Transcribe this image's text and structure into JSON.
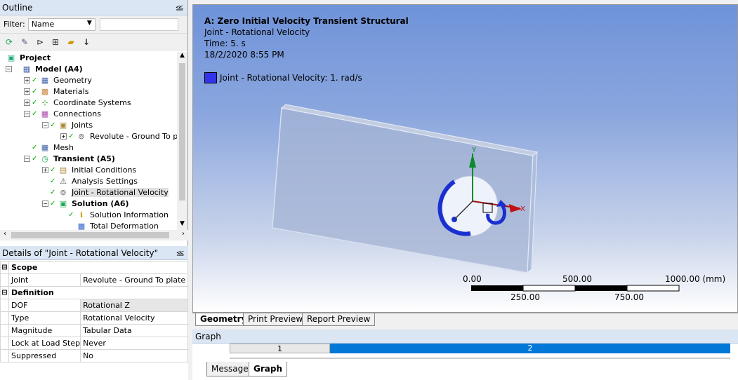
{
  "outline": {
    "title": "Outline",
    "pin": "⪣",
    "filter_label": "Filter:",
    "filter_value": "Name",
    "tree": [
      {
        "label": "Project",
        "indent": 0,
        "exp": "",
        "check": "",
        "icon": "project-icon",
        "bold": true
      },
      {
        "label": "Model (A4)",
        "indent": 1,
        "exp": "-",
        "check": "",
        "icon": "model-icon",
        "bold": true
      },
      {
        "label": "Geometry",
        "indent": 2,
        "exp": "+",
        "check": "✓",
        "icon": "geometry-icon",
        "bold": false
      },
      {
        "label": "Materials",
        "indent": 2,
        "exp": "+",
        "check": "✓",
        "icon": "materials-icon",
        "bold": false
      },
      {
        "label": "Coordinate Systems",
        "indent": 2,
        "exp": "+",
        "check": "✓",
        "icon": "coordinate-systems-icon",
        "bold": false
      },
      {
        "label": "Connections",
        "indent": 2,
        "exp": "-",
        "check": "✓",
        "icon": "connections-icon",
        "bold": false
      },
      {
        "label": "Joints",
        "indent": 3,
        "exp": "-",
        "check": "✓",
        "icon": "joints-icon",
        "bold": false
      },
      {
        "label": "Revolute - Ground To pl",
        "indent": 4,
        "exp": "+",
        "check": "✓",
        "icon": "revolute-joint-icon",
        "bold": false
      },
      {
        "label": "Mesh",
        "indent": 2,
        "exp": "",
        "check": "✓",
        "icon": "mesh-icon",
        "bold": false
      },
      {
        "label": "Transient (A5)",
        "indent": 2,
        "exp": "-",
        "check": "✓",
        "icon": "transient-icon",
        "bold": true
      },
      {
        "label": "Initial Conditions",
        "indent": 3,
        "exp": "+",
        "check": "✓",
        "icon": "initial-conditions-icon",
        "bold": false
      },
      {
        "label": "Analysis Settings",
        "indent": 3,
        "exp": "",
        "check": "✓",
        "icon": "analysis-settings-icon",
        "bold": false
      },
      {
        "label": "Joint - Rotational Velocity",
        "indent": 3,
        "exp": "",
        "check": "✓",
        "icon": "joint-load-icon",
        "bold": false,
        "selected": true
      },
      {
        "label": "Solution (A6)",
        "indent": 3,
        "exp": "-",
        "check": "✓",
        "icon": "solution-icon",
        "bold": true
      },
      {
        "label": "Solution Information",
        "indent": 4,
        "exp": "",
        "check": "✓",
        "icon": "solution-information-icon",
        "bold": false
      },
      {
        "label": "Total Deformation",
        "indent": 4,
        "exp": "",
        "check": "",
        "icon": "total-deformation-icon",
        "bold": false
      }
    ]
  },
  "details": {
    "title": "Details of \"Joint - Rotational Velocity\"",
    "pin": "⪣",
    "sections": [
      {
        "name": "Scope",
        "rows": [
          {
            "key": "Joint",
            "value": "Revolute - Ground To plate"
          }
        ]
      },
      {
        "name": "Definition",
        "rows": [
          {
            "key": "DOF",
            "value": "Rotational Z",
            "highlight": true
          },
          {
            "key": "Type",
            "value": "Rotational Velocity"
          },
          {
            "key": "Magnitude",
            "value": "Tabular Data"
          },
          {
            "key": "Lock at Load Step",
            "value": "Never"
          },
          {
            "key": "Suppressed",
            "value": "No"
          }
        ]
      }
    ]
  },
  "viewport": {
    "title": "A: Zero Initial Velocity Transient Structural",
    "subtitle": "Joint - Rotational Velocity",
    "time": "Time: 5. s",
    "date": "18/2/2020 8:55 PM",
    "legend": "Joint - Rotational Velocity: 1. rad/s",
    "legend_color": "#3333ee",
    "axis_y": "Y",
    "axis_x": "X",
    "scale": {
      "top_labels": [
        "0.00",
        "500.00",
        "1000.00 (mm)"
      ],
      "bottom_labels": [
        "250.00",
        "750.00"
      ]
    }
  },
  "view_tabs": [
    "Geometry",
    "Print Preview",
    "Report Preview"
  ],
  "graph": {
    "title": "Graph",
    "step1": "1",
    "step2": "2",
    "accent": "#0078d7"
  },
  "bottom_tabs": [
    "Messages",
    "Graph"
  ]
}
